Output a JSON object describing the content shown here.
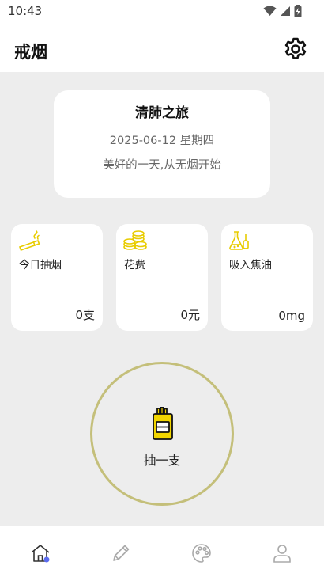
{
  "status_bar": {
    "time": "10:43",
    "icons": [
      "wifi-icon",
      "signal-icon",
      "battery-icon"
    ]
  },
  "header": {
    "title": "戒烟",
    "settings_icon": "gear-icon"
  },
  "hero": {
    "title": "清肺之旅",
    "date": "2025-06-12 星期四",
    "subtitle": "美好的一天,从无烟开始"
  },
  "stats": [
    {
      "icon": "cigarette-icon",
      "label": "今日抽烟",
      "value": "0支"
    },
    {
      "icon": "coins-icon",
      "label": "花费",
      "value": "0元"
    },
    {
      "icon": "flask-icon",
      "label": "吸入焦油",
      "value": "0mg"
    }
  ],
  "smoke_button": {
    "icon": "cigarette-pack-icon",
    "label": "抽一支"
  },
  "tabbar": {
    "tabs": [
      {
        "icon": "home-icon",
        "active": true
      },
      {
        "icon": "pencil-icon",
        "active": false
      },
      {
        "icon": "palette-icon",
        "active": false
      },
      {
        "icon": "user-icon",
        "active": false
      }
    ]
  },
  "colors": {
    "accent_yellow": "#f2d600",
    "circle_border": "#c4bf7a",
    "active_dot": "#5b6cf0",
    "background": "#ededed"
  }
}
